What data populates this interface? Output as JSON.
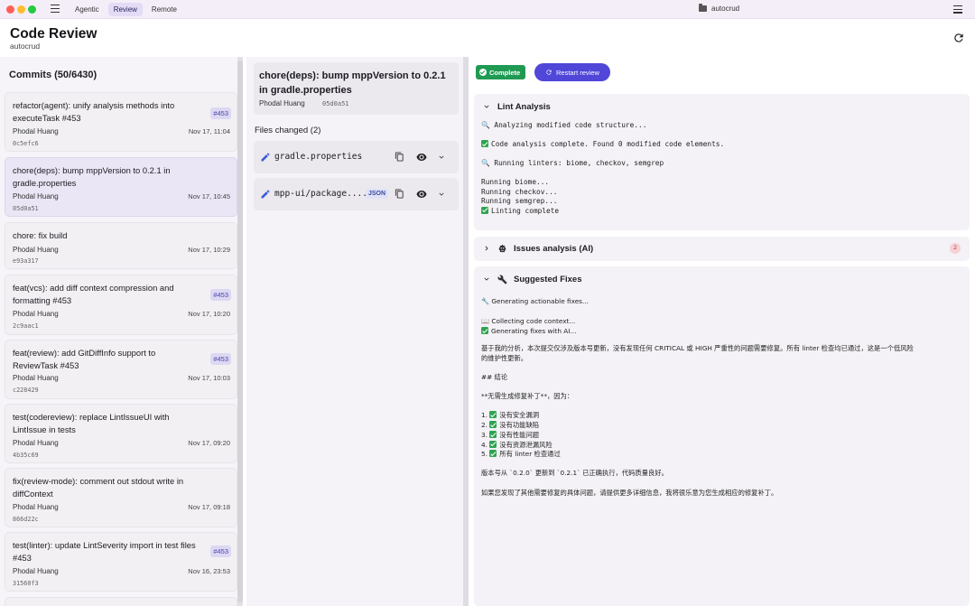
{
  "titlebar": {
    "tabs": [
      "Agentic",
      "Review",
      "Remote"
    ],
    "active_tab": "Review",
    "window_title": "autocrud"
  },
  "header": {
    "title": "Code Review",
    "subtitle": "autocrud"
  },
  "commits": {
    "heading": "Commits (50/6430)",
    "items": [
      {
        "title": "refactor(agent): unify analysis methods into executeTask #453",
        "badge": "#453",
        "author": "Phodal Huang",
        "date": "Nov 17, 11:04",
        "hash": "0c5efc6"
      },
      {
        "title": "chore(deps): bump mppVersion to 0.2.1 in gradle.properties",
        "badge": "",
        "author": "Phodal Huang",
        "date": "Nov 17, 10:45",
        "hash": "05d0a51"
      },
      {
        "title": "chore: fix build",
        "badge": "",
        "author": "Phodal Huang",
        "date": "Nov 17, 10:29",
        "hash": "e93a317"
      },
      {
        "title": "feat(vcs): add diff context compression and formatting #453",
        "badge": "#453",
        "author": "Phodal Huang",
        "date": "Nov 17, 10:20",
        "hash": "2c9aac1"
      },
      {
        "title": "feat(review): add GitDiffInfo support to ReviewTask #453",
        "badge": "#453",
        "author": "Phodal Huang",
        "date": "Nov 17, 10:03",
        "hash": "c228429"
      },
      {
        "title": "test(codereview): replace LintIssueUI with LintIssue in tests",
        "badge": "",
        "author": "Phodal Huang",
        "date": "Nov 17, 09:20",
        "hash": "4b35c69"
      },
      {
        "title": "fix(review-mode): comment out stdout write in diffContext",
        "badge": "",
        "author": "Phodal Huang",
        "date": "Nov 17, 09:18",
        "hash": "866d22c"
      },
      {
        "title": "test(linter): update LintSeverity import in test files #453",
        "badge": "#453",
        "author": "Phodal Huang",
        "date": "Nov 16, 23:53",
        "hash": "31560f3"
      }
    ]
  },
  "detail": {
    "title": "chore(deps): bump mppVersion to 0.2.1 in gradle.properties",
    "author": "Phodal Huang",
    "hash": "05d0a51",
    "files_heading": "Files changed (2)",
    "files": [
      {
        "name": "gradle.properties",
        "tag": ""
      },
      {
        "name": "mpp-ui/package....",
        "tag": "JSON"
      }
    ]
  },
  "review": {
    "status": "Complete",
    "restart_label": "Restart review",
    "lint": {
      "title": "Lint Analysis",
      "lines": [
        "🔍 Analyzing modified code structure...",
        "Code analysis complete. Found 0 modified code elements.",
        "🔍 Running linters: biome, checkov, semgrep",
        "Running biome...",
        "Running checkov...",
        "Running semgrep...",
        "Linting complete"
      ]
    },
    "issues": {
      "title": "Issues analysis (AI)",
      "count": "2"
    },
    "fixes": {
      "title": "Suggested Fixes",
      "lines": [
        "🔧 Generating actionable fixes...",
        "📖 Collecting code context...",
        "Generating fixes with AI...",
        "基于我的分析，本次提交仅涉及版本号更新，没有发现任何 CRITICAL 或 HIGH 严重性的问题需要修复。所有 linter 检查均已通过，这是一个低风险",
        "的维护性更新。",
        "## 结论",
        "**无需生成修复补丁**，因为：",
        "1. ",
        "没有安全漏洞",
        "2. ",
        "没有功能缺陷",
        "3. ",
        "没有性能问题",
        "4. ",
        "没有资源泄漏风险",
        "5. ",
        "所有 linter 检查通过",
        "版本号从 `0.2.0` 更新到 `0.2.1` 已正确执行，代码质量良好。",
        "如果您发现了其他需要修复的具体问题，请提供更多详细信息，我将很乐意为您生成相应的修复补丁。"
      ]
    }
  },
  "colors": {
    "accent": "#5046d8",
    "success": "#1f9a52",
    "badge_bg": "#dcd8f3",
    "selected_bg": "#ebe6f5"
  }
}
